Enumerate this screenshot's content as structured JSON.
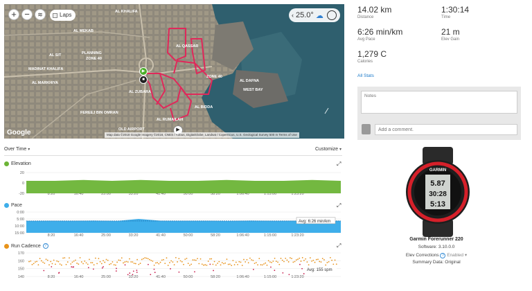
{
  "map": {
    "laps_label": "Laps",
    "temperature": "25.0°",
    "google": "Google",
    "attribution": "Map data ©2018 Google Imagery ©2018, CNES / Airbus, DigitalGlobe, Landsat / Copernicus, U.S. Geological Survey    500 m     Terms of Use",
    "place_labels": [
      "AL KHALIFA",
      "AL MEKAB",
      "AL QASSAR",
      "AL SIT",
      "ZONE 40",
      "PLANNING ZONE 40",
      "AL ZUBARA",
      "WEST BAY",
      "AL DAFNA",
      "FEREEJ BIN OMRAN",
      "AL MARKHIYA",
      "MADINAT KHALIFA",
      "AL RUMAILAH",
      "OLD AIRPORT",
      "AL BIDDA"
    ]
  },
  "stats": [
    {
      "value": "14.02 km",
      "label": "Distance"
    },
    {
      "value": "1:30:14",
      "label": "Time"
    },
    {
      "value": "6:26 min/km",
      "label": "Avg Pace"
    },
    {
      "value": "21 m",
      "label": "Elev Gain"
    },
    {
      "value": "1,279 C",
      "label": "Calories"
    }
  ],
  "all_stats_link": "All Stats",
  "notes": {
    "placeholder": "Notes",
    "comment_placeholder": "Add a comment."
  },
  "controls": {
    "over_time": "Over Time",
    "customize": "Customize"
  },
  "charts": [
    {
      "title": "Elevation",
      "color": "#6cb436",
      "chart_data": {
        "type": "area",
        "y_ticks": [
          "20",
          "0",
          "-20"
        ],
        "x_ticks": [
          "8:20",
          "16:40",
          "25:00",
          "33:20",
          "41:40",
          "50:00",
          "58:20",
          "1:06:40",
          "1:15:00",
          "1:23:20"
        ],
        "values": [
          5,
          5,
          6,
          5,
          6,
          5,
          5,
          6,
          5,
          5,
          6,
          5
        ]
      }
    },
    {
      "title": "Pace",
      "color": "#3eaeea",
      "avg_label": "Avg: 6:26 min/km",
      "chart_data": {
        "type": "area",
        "y_ticks": [
          "0:00",
          "5:00",
          "10:00",
          "15:00"
        ],
        "x_ticks": [
          "8:20",
          "16:40",
          "25:00",
          "33:20",
          "41:40",
          "50:00",
          "58:20",
          "1:06:40",
          "1:15:00",
          "1:23:20"
        ],
        "values": [
          6.5,
          6.3,
          6.4,
          6.2,
          6.5,
          5.0,
          6.3,
          6.4,
          6.3,
          6.5,
          6.2,
          6.4,
          6.3,
          6.1,
          6.4
        ]
      }
    },
    {
      "title": "Run Cadence",
      "color": "#e8931b",
      "avg_label": "Avg: 155 spm",
      "chart_data": {
        "type": "scatter",
        "y_ticks": [
          "170",
          "160",
          "150",
          "140"
        ],
        "x_ticks": [
          "8:20",
          "16:40",
          "25:00",
          "33:20",
          "41:40",
          "50:00",
          "58:20",
          "1:06:40",
          "1:15:00",
          "1:23:20"
        ],
        "ylim": [
          140,
          170
        ]
      }
    }
  ],
  "device": {
    "name": "Garmin Forerunner 220",
    "software_label": "Software: 3.10.0.0",
    "elev_label": "Elev Corrections",
    "elev_value": "Enabled",
    "summary": "Summary Data: Original",
    "watch_brand": "GARMIN",
    "watch_lines": [
      "5.87",
      "30:28",
      "5:13"
    ]
  }
}
